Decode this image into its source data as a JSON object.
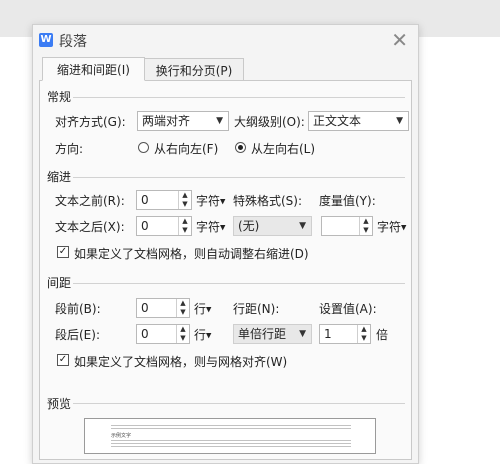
{
  "dialog": {
    "title": "段落",
    "logo": "W",
    "close_glyph": "✕"
  },
  "tabs": [
    {
      "label": "缩进和间距(I)",
      "active": true
    },
    {
      "label": "换行和分页(P)",
      "active": false
    }
  ],
  "general": {
    "section_label": "常规",
    "align_label": "对齐方式(G):",
    "align_value": "两端对齐",
    "outline_label": "大纲级别(O):",
    "outline_value": "正文文本",
    "direction_label": "方向:",
    "direction_rtl": "从右向左(F)",
    "direction_ltr": "从左向右(L)",
    "direction_selected": "ltr"
  },
  "indent": {
    "section_label": "缩进",
    "before_text_label": "文本之前(R):",
    "before_text_value": "0",
    "before_text_unit": "字符",
    "after_text_label": "文本之后(X):",
    "after_text_value": "0",
    "after_text_unit": "字符",
    "special_label": "特殊格式(S):",
    "special_value": "(无)",
    "measure_label": "度量值(Y):",
    "measure_value": "",
    "measure_unit": "字符",
    "grid_checkbox_label": "如果定义了文档网格，则自动调整右缩进(D)",
    "grid_checked": true
  },
  "spacing": {
    "section_label": "间距",
    "before_label": "段前(B):",
    "before_value": "0",
    "before_unit": "行",
    "after_label": "段后(E):",
    "after_value": "0",
    "after_unit": "行",
    "line_label": "行距(N):",
    "line_value": "单倍行距",
    "setting_label": "设置值(A):",
    "setting_value": "1",
    "setting_unit": "倍",
    "grid_checkbox_label": "如果定义了文档网格，则与网格对齐(W)",
    "grid_checked": true
  },
  "preview": {
    "section_label": "预览",
    "sample_text": "示例文字"
  },
  "icons": {
    "dropdown": "chevron-down-icon",
    "spinner": "spinner-arrows-icon",
    "check": "✓"
  },
  "colors": {
    "logo_blue": "#3b7cf4",
    "dialog_bg": "#f4f4f4",
    "panel_bg": "#fafafa"
  }
}
